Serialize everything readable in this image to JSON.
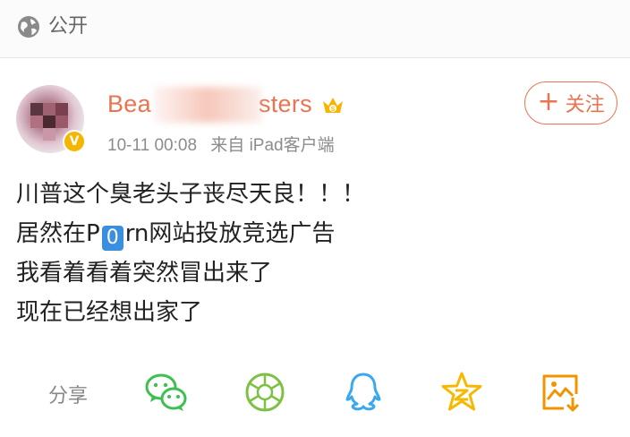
{
  "visibility": {
    "icon": "globe-icon",
    "label": "公开"
  },
  "post": {
    "author": {
      "name": "Beauty Monsters",
      "name_visible_start": "Bea",
      "name_visible_end": "sters",
      "avatar": "blurred-avatar",
      "verified_badge": "V",
      "crown_badge": "crown-icon"
    },
    "timestamp": "10-11 00:08",
    "source": "来自 iPad客户端",
    "follow_label": "关注",
    "content": {
      "line1": "川普这个臭老头子丧尽天良！！！",
      "line2_prefix": "居然在P",
      "line2_zero": "0",
      "line2_suffix": "rn网站投放竞选广告",
      "line3": "我看着看着突然冒出来了",
      "line4": "现在已经想出家了"
    }
  },
  "share": {
    "label": "分享",
    "targets": [
      "wechat-icon",
      "moments-icon",
      "qq-icon",
      "qzone-icon",
      "save-image-icon"
    ]
  },
  "colors": {
    "accent": "#eb7350",
    "wechat": "#3ebf52",
    "moments": "#7dc142",
    "qq": "#39a8f0",
    "qzone": "#f6b800",
    "save": "#f29400"
  }
}
